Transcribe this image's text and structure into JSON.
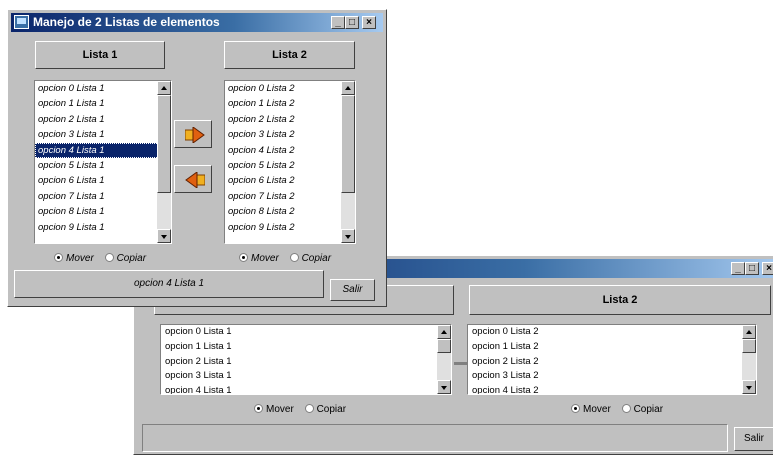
{
  "back_window": {
    "title_buttons": [
      "_",
      "□",
      "×"
    ],
    "header_list2": "Lista 2",
    "list1_items": [
      "opcion 0 Lista 1",
      "opcion 1 Lista 1",
      "opcion 2 Lista 1",
      "opcion 3 Lista 1",
      "opcion 4 Lista 1"
    ],
    "list2_items": [
      "opcion 0 Lista 2",
      "opcion 1 Lista 2",
      "opcion 2 Lista 2",
      "opcion 3 Lista 2",
      "opcion 4 Lista 2"
    ],
    "radio_mover": "Mover",
    "radio_copiar": "Copiar",
    "salir": "Salir",
    "status": ""
  },
  "front_window": {
    "title": "Manejo de 2 Listas de elementos",
    "title_buttons": [
      "_",
      "□",
      "×"
    ],
    "header_list1": "Lista 1",
    "header_list2": "Lista 2",
    "list1_items": [
      "opcion 0 Lista 1",
      "opcion 1 Lista 1",
      "opcion 2 Lista 1",
      "opcion 3 Lista 1",
      "opcion 4 Lista 1",
      "opcion 5 Lista 1",
      "opcion 6 Lista 1",
      "opcion 7 Lista 1",
      "opcion 8 Lista 1",
      "opcion 9 Lista 1"
    ],
    "list1_selected": "opcion 4 Lista 1",
    "list2_items": [
      "opcion 0 Lista 2",
      "opcion 1 Lista 2",
      "opcion 2 Lista 2",
      "opcion 3 Lista 2",
      "opcion 4 Lista 2",
      "opcion 5 Lista 2",
      "opcion 6 Lista 2",
      "opcion 7 Lista 2",
      "opcion 8 Lista 2",
      "opcion 9 Lista 2"
    ],
    "radio_mover": "Mover",
    "radio_copiar": "Copiar",
    "radio_selected": "Mover",
    "status": "opcion 4 Lista 1",
    "salir": "Salir",
    "move_right_icon": "arrow-right-icon",
    "move_left_icon": "arrow-left-icon",
    "arrow_color": "#e06010"
  }
}
